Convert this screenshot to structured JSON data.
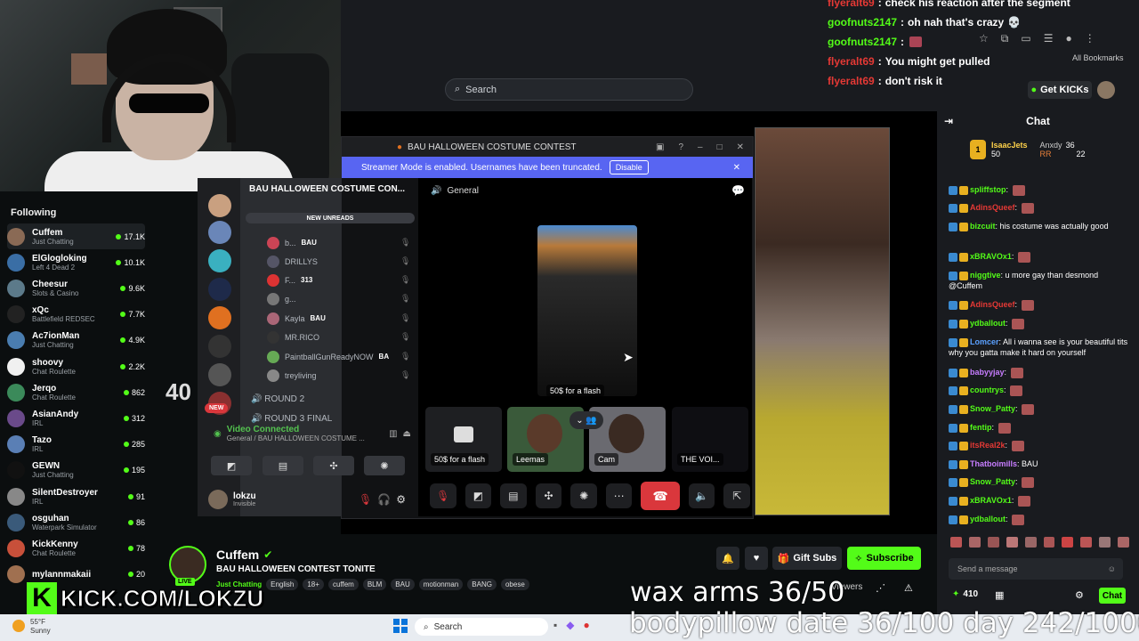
{
  "colors": {
    "kick_green": "#53fc18",
    "discord_blurple": "#5865f2",
    "hangup_red": "#da373c"
  },
  "top_chat": [
    {
      "name": "flyeralt69",
      "text": "check his reaction after the segment",
      "color": "#e53935"
    },
    {
      "name": "goofnuts2147",
      "text": "oh nah that's crazy",
      "color": "#53fc18"
    },
    {
      "name": "goofnuts2147",
      "text": "",
      "color": "#53fc18"
    },
    {
      "name": "flyeralt69",
      "text": "You might get pulled",
      "color": "#e53935"
    },
    {
      "name": "flyeralt69",
      "text": "don't risk it",
      "color": "#e53935"
    }
  ],
  "browser": {
    "search_placeholder": "Search",
    "get_kicks": "Get KICKs",
    "bookmarks": "All Bookmarks"
  },
  "sidebar": {
    "header": "Following",
    "items": [
      {
        "name": "Cuffem",
        "category": "Just Chatting",
        "viewers": "17.1K",
        "color": "#8a6a55"
      },
      {
        "name": "ElGlogloking",
        "category": "Left 4 Dead 2",
        "viewers": "10.1K",
        "color": "#3a6ea5"
      },
      {
        "name": "Cheesur",
        "category": "Slots & Casino",
        "viewers": "9.6K",
        "color": "#5c7a8a"
      },
      {
        "name": "xQc",
        "category": "Battlefield REDSEC",
        "viewers": "7.7K",
        "color": "#222"
      },
      {
        "name": "Ac7ionMan",
        "category": "Just Chatting",
        "viewers": "4.9K",
        "color": "#4a7db0"
      },
      {
        "name": "shoovy",
        "category": "Chat Roulette",
        "viewers": "2.2K",
        "color": "#f0f0f0"
      },
      {
        "name": "Jerqo",
        "category": "Chat Roulette",
        "viewers": "862",
        "color": "#3b8a5a"
      },
      {
        "name": "AsianAndy",
        "category": "IRL",
        "viewers": "312",
        "color": "#6a4a8a"
      },
      {
        "name": "Tazo",
        "category": "IRL",
        "viewers": "285",
        "color": "#5a7fb5"
      },
      {
        "name": "GEWN",
        "category": "Just Chatting",
        "viewers": "195",
        "color": "#111"
      },
      {
        "name": "SilentDestroyer",
        "category": "IRL",
        "viewers": "91",
        "color": "#888"
      },
      {
        "name": "osguhan",
        "category": "Waterpark Simulator",
        "viewers": "86",
        "color": "#3a5a7a"
      },
      {
        "name": "KickKenny",
        "category": "Chat Roulette",
        "viewers": "78",
        "color": "#c8503a"
      },
      {
        "name": "mylannmakaii",
        "category": "",
        "viewers": "20",
        "color": "#a07050"
      }
    ]
  },
  "discord": {
    "window_title": "BAU HALLOWEEN COSTUME CONTEST",
    "streamer_mode": "Streamer Mode is enabled. Usernames have been truncated.",
    "disable": "Disable",
    "server_name": "BAU HALLOWEEN COSTUME CON...",
    "new_unreads": "NEW UNREADS",
    "channel": "General",
    "members": [
      {
        "name": "b...",
        "tag": "BAU",
        "color": "#c45"
      },
      {
        "name": "DRILLYS",
        "tag": "",
        "color": "#556"
      },
      {
        "name": "F...",
        "tag": "313",
        "color": "#d33"
      },
      {
        "name": "g...",
        "tag": "",
        "color": "#777"
      },
      {
        "name": "Kayla",
        "tag": "BAU",
        "color": "#a67"
      },
      {
        "name": "MR.RICO",
        "tag": "",
        "color": "#333"
      },
      {
        "name": "PaintballGunReadyNOW",
        "tag": "BA",
        "color": "#6a5"
      },
      {
        "name": "treyliving",
        "tag": "",
        "color": "#888"
      }
    ],
    "round2": "ROUND 2",
    "round3": "ROUND 3 FINAL",
    "new_badge": "NEW",
    "voice_status": "Video Connected",
    "voice_sub": "General / BAU HALLOWEEN COSTUME ...",
    "username": "lokzu",
    "user_status": "Invisible",
    "main_tile_label": "50$ for a flash",
    "tiles": [
      {
        "label": "50$ for a flash"
      },
      {
        "label": "Leemas"
      },
      {
        "label": "Cam"
      },
      {
        "label": "THE VOI..."
      }
    ]
  },
  "overlay_40": "40",
  "chat": {
    "title": "Chat",
    "leaderboard": [
      {
        "name": "IsaacJets",
        "value": "50"
      },
      {
        "name": "Anxdy",
        "value": "36"
      },
      {
        "name": "RR",
        "value": "22"
      }
    ],
    "messages": [
      {
        "name": "spliffstop",
        "text": "",
        "color": "#53fc18"
      },
      {
        "name": "AdinsQueef",
        "text": "",
        "color": "#e53935"
      },
      {
        "name": "bizcuit",
        "text": "his costume was actually good",
        "color": "#53fc18"
      },
      {
        "name": "xBRAVOx1",
        "text": "",
        "color": "#53fc18"
      },
      {
        "name": "niggtive",
        "text": "u more gay than desmond @Cuffem",
        "color": "#53fc18"
      },
      {
        "name": "AdinsQueef",
        "text": "",
        "color": "#e53935"
      },
      {
        "name": "ydballout",
        "text": "",
        "color": "#53fc18"
      },
      {
        "name": "Lomcer",
        "text": "All i wanna see is your beautiful tits why you gatta make it hard on yourself",
        "color": "#5aa0ff"
      },
      {
        "name": "babyyjay",
        "text": "",
        "color": "#c77dff"
      },
      {
        "name": "countrys",
        "text": "",
        "color": "#53fc18"
      },
      {
        "name": "Snow_Patty",
        "text": "",
        "color": "#53fc18"
      },
      {
        "name": "fentip",
        "text": "",
        "color": "#53fc18"
      },
      {
        "name": "itsReal2k",
        "text": "",
        "color": "#e53935"
      },
      {
        "name": "Thatboimills",
        "text": "BAU",
        "color": "#c77dff"
      },
      {
        "name": "Snow_Patty",
        "text": "",
        "color": "#53fc18"
      },
      {
        "name": "xBRAVOx1",
        "text": "",
        "color": "#53fc18"
      },
      {
        "name": "ydballout",
        "text": "",
        "color": "#53fc18"
      }
    ],
    "send_placeholder": "Send a message",
    "points": "410",
    "chat_button": "Chat"
  },
  "channel": {
    "name": "Cuffem",
    "title": "BAU HALLOWEEN CONTEST TONITE",
    "category": "Just Chatting",
    "tags": [
      "English",
      "18+",
      "cuffem",
      "BLM",
      "BAU",
      "motionman",
      "BANG",
      "obese"
    ],
    "live": "LIVE",
    "viewers_label": "Viewers",
    "gift": "Gift Subs",
    "subscribe": "Subscribe"
  },
  "overlays": {
    "kick_url": "KICK.COM/LOKZU",
    "wax": "wax arms 36/50",
    "bodypillow": "bodypillow date 36/100   day 242/1000"
  },
  "taskbar": {
    "temp": "55°F",
    "weather": "Sunny",
    "search": "Search"
  }
}
